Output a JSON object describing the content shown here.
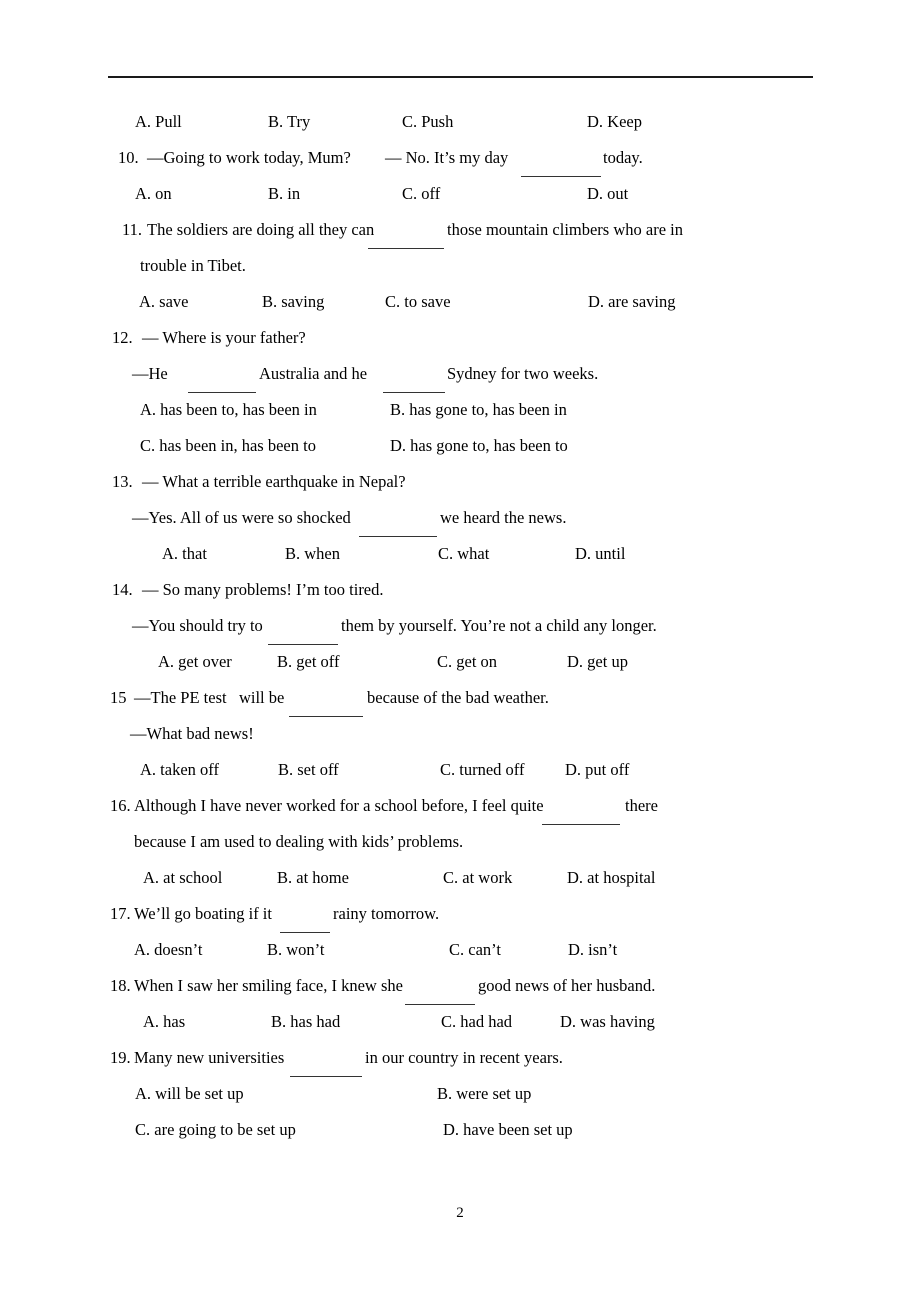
{
  "document": {
    "page_number": "2",
    "rule_color": "#1a1a1a"
  },
  "questions": [
    {
      "id": "q9-options",
      "type": "options-row",
      "options": [
        "A. Pull",
        "B. Try",
        "C. Push",
        "D. Keep"
      ]
    },
    {
      "id": "q10",
      "number": "10.",
      "stem_left": "—Going to work today, Mum?",
      "stem_right_pre": "— No. It’s my day",
      "stem_right_post": "today.",
      "options": [
        "A. on",
        "B. in",
        "C. off",
        "D. out"
      ]
    },
    {
      "id": "q11",
      "number": "11.",
      "stem_pre": "The soldiers are doing all they can",
      "stem_post": "those mountain climbers who are in",
      "stem_line2": "trouble in Tibet.",
      "options": [
        "A. save",
        "B. saving",
        "C. to save",
        "D. are saving"
      ]
    },
    {
      "id": "q12",
      "number": "12.",
      "stem": "— Where is your father?",
      "stem_line2_pre": "—He",
      "stem_line2_mid": "Australia and he",
      "stem_line2_post": "Sydney for two weeks.",
      "options": [
        "A. has been to, has been in",
        "B. has gone to, has been in",
        "C. has been in, has been to",
        "D. has gone to, has been to"
      ]
    },
    {
      "id": "q13",
      "number": "13.",
      "stem": "— What a terrible earthquake in Nepal?",
      "stem_line2_pre": "—Yes. All of us were so shocked",
      "stem_line2_post": "we heard the news.",
      "options": [
        "A. that",
        "B. when",
        "C. what",
        "D. until"
      ]
    },
    {
      "id": "q14",
      "number": "14.",
      "stem": "— So many problems! I’m too tired.",
      "stem_line2_pre": "—You should try to",
      "stem_line2_post": "them by yourself. You’re not a child any longer.",
      "options": [
        "A. get over",
        "B. get off",
        "C. get on",
        "D. get up"
      ]
    },
    {
      "id": "q15",
      "number": "15",
      "stem_pre": "—The PE test   will be",
      "stem_post": "because of the bad weather.",
      "stem_line2": "—What bad news!",
      "options": [
        "A. taken off",
        "B. set off",
        "C. turned off",
        "D. put off"
      ]
    },
    {
      "id": "q16",
      "number": "16.",
      "stem_pre": "Although I have never worked for a school before, I feel quite",
      "stem_post": "there",
      "stem_line2": "because I am used to dealing with kids’ problems.",
      "options": [
        "A. at school",
        "B. at home",
        "C. at work",
        "D. at hospital"
      ]
    },
    {
      "id": "q17",
      "number": "17.",
      "stem_pre": "We’ll go boating if it",
      "stem_post": "rainy tomorrow.",
      "options": [
        "A. doesn’t",
        "B. won’t",
        "C. can’t",
        "D. isn’t"
      ]
    },
    {
      "id": "q18",
      "number": "18.",
      "stem_pre": "When I saw her smiling face, I knew she",
      "stem_post": "good news of her husband.",
      "options": [
        "A. has",
        "B. has had",
        "C. had had",
        "D. was having"
      ]
    },
    {
      "id": "q19",
      "number": "19.",
      "stem_pre": "Many new universities",
      "stem_post": "in our country in recent years.",
      "options": [
        "A. will be set up",
        "B. were set up",
        "C. are going to be set up",
        "D. have been set up"
      ]
    }
  ]
}
